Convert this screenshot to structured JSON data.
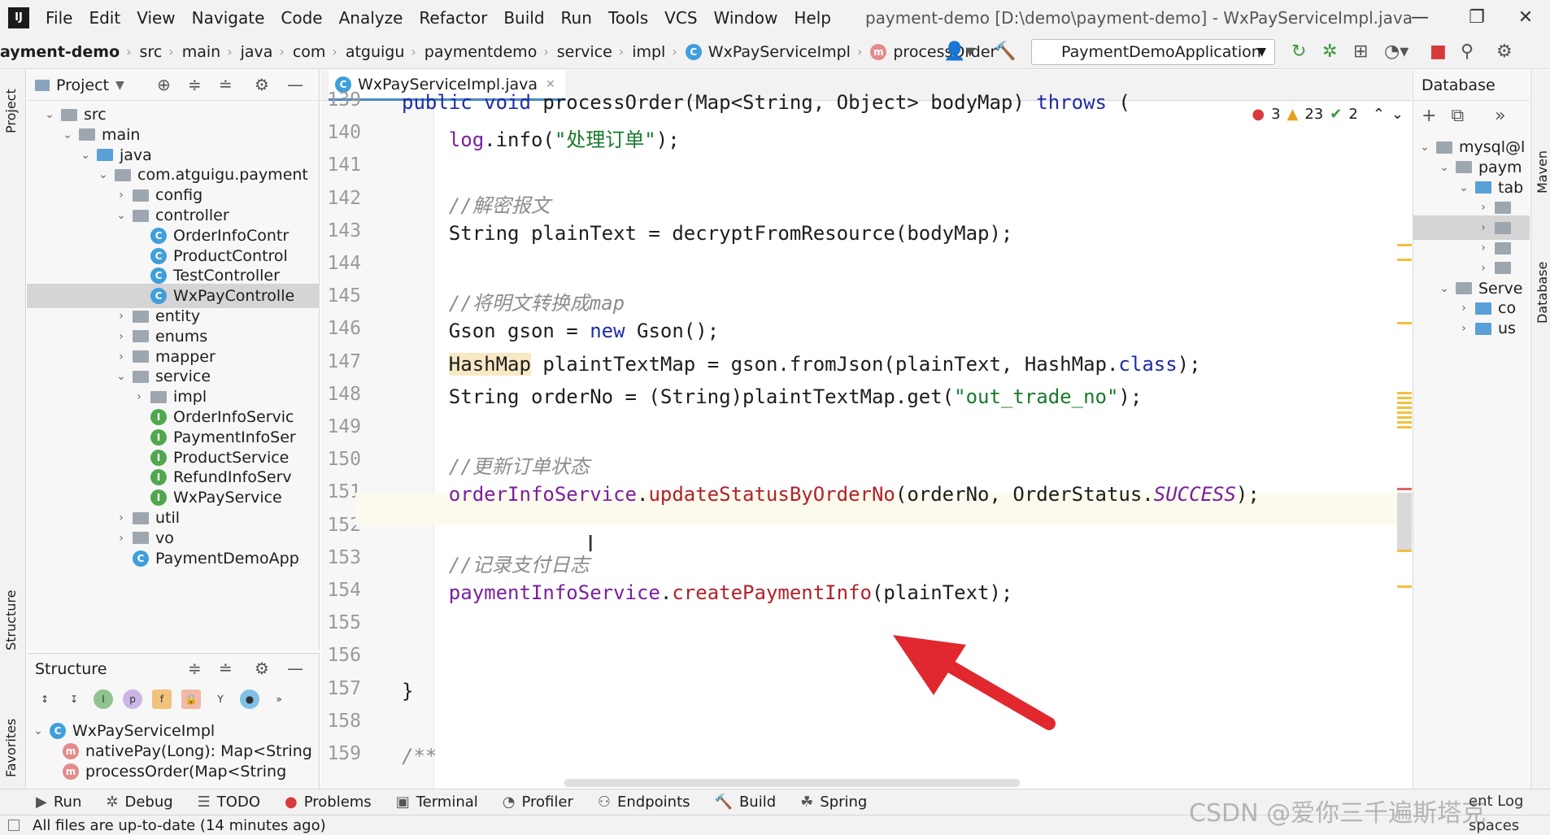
{
  "app": {
    "logo_text": "IJ"
  },
  "menu": {
    "items": [
      "File",
      "Edit",
      "View",
      "Navigate",
      "Code",
      "Analyze",
      "Refactor",
      "Build",
      "Run",
      "Tools",
      "VCS",
      "Window",
      "Help"
    ],
    "title": "payment-demo [D:\\demo\\payment-demo] - WxPayServiceImpl.java"
  },
  "window_controls": {
    "minimize": "—",
    "restore": "❐",
    "close": "✕"
  },
  "breadcrumbs": [
    "ayment-demo",
    "src",
    "main",
    "java",
    "com",
    "atguigu",
    "paymentdemo",
    "service",
    "impl",
    "WxPayServiceImpl",
    "processOrder"
  ],
  "run_config": {
    "name": "PaymentDemoApplication"
  },
  "project_panel": {
    "title": "Project",
    "tree": [
      {
        "label": "src",
        "depth": 0,
        "expanded": true,
        "type": "folder"
      },
      {
        "label": "main",
        "depth": 1,
        "expanded": true,
        "type": "folder"
      },
      {
        "label": "java",
        "depth": 2,
        "expanded": true,
        "type": "folder-blue"
      },
      {
        "label": "com.atguigu.payment",
        "depth": 3,
        "expanded": true,
        "type": "package"
      },
      {
        "label": "config",
        "depth": 4,
        "expanded": false,
        "type": "package"
      },
      {
        "label": "controller",
        "depth": 4,
        "expanded": true,
        "type": "package"
      },
      {
        "label": "OrderInfoContr",
        "depth": 5,
        "type": "class"
      },
      {
        "label": "ProductControl",
        "depth": 5,
        "type": "class"
      },
      {
        "label": "TestController",
        "depth": 5,
        "type": "class"
      },
      {
        "label": "WxPayControlle",
        "depth": 5,
        "type": "class",
        "selected": true
      },
      {
        "label": "entity",
        "depth": 4,
        "expanded": false,
        "type": "package"
      },
      {
        "label": "enums",
        "depth": 4,
        "expanded": false,
        "type": "package"
      },
      {
        "label": "mapper",
        "depth": 4,
        "expanded": false,
        "type": "package"
      },
      {
        "label": "service",
        "depth": 4,
        "expanded": true,
        "type": "package"
      },
      {
        "label": "impl",
        "depth": 5,
        "expanded": false,
        "type": "package"
      },
      {
        "label": "OrderInfoServic",
        "depth": 5,
        "type": "interface"
      },
      {
        "label": "PaymentInfoSer",
        "depth": 5,
        "type": "interface"
      },
      {
        "label": "ProductService",
        "depth": 5,
        "type": "interface"
      },
      {
        "label": "RefundInfoServ",
        "depth": 5,
        "type": "interface"
      },
      {
        "label": "WxPayService",
        "depth": 5,
        "type": "interface"
      },
      {
        "label": "util",
        "depth": 4,
        "expanded": false,
        "type": "package"
      },
      {
        "label": "vo",
        "depth": 4,
        "expanded": false,
        "type": "package"
      },
      {
        "label": "PaymentDemoApp",
        "depth": 4,
        "type": "class"
      }
    ]
  },
  "structure_panel": {
    "title": "Structure",
    "tree": [
      {
        "label": "WxPayServiceImpl",
        "depth": 0,
        "type": "class"
      },
      {
        "label": "nativePay(Long): Map<String",
        "depth": 1,
        "type": "method"
      },
      {
        "label": "processOrder(Map<String",
        "depth": 1,
        "type": "method"
      }
    ]
  },
  "left_strip": {
    "project": "Project",
    "structure": "Structure",
    "favorites": "Favorites"
  },
  "editor": {
    "tab": "WxPayServiceImpl.java",
    "inspections": {
      "errors": "3",
      "warnings": "23",
      "weak": "2"
    },
    "lines": [
      {
        "n": "139",
        "segments": [
          {
            "t": "public void ",
            "c": "kw"
          },
          {
            "t": "processOrder",
            "c": "fn"
          },
          {
            "t": "(Map<String, Object> bodyMap) ",
            "c": ""
          },
          {
            "t": "throws",
            "c": "kw"
          },
          {
            "t": " (",
            "c": ""
          }
        ]
      },
      {
        "n": "140",
        "segments": [
          {
            "t": "    ",
            "c": ""
          },
          {
            "t": "log",
            "c": "fld"
          },
          {
            "t": ".info(",
            "c": ""
          },
          {
            "t": "\"处理订单\"",
            "c": "str"
          },
          {
            "t": ");",
            "c": ""
          }
        ]
      },
      {
        "n": "141",
        "segments": []
      },
      {
        "n": "142",
        "segments": [
          {
            "t": "    //解密报文",
            "c": "cm"
          }
        ]
      },
      {
        "n": "143",
        "segments": [
          {
            "t": "    String plainText = decryptFromResource(bodyMap);",
            "c": ""
          }
        ]
      },
      {
        "n": "144",
        "segments": []
      },
      {
        "n": "145",
        "segments": [
          {
            "t": "    //将明文转换成map",
            "c": "cm"
          }
        ]
      },
      {
        "n": "146",
        "segments": [
          {
            "t": "    Gson gson = ",
            "c": ""
          },
          {
            "t": "new",
            "c": "kw"
          },
          {
            "t": " Gson();",
            "c": ""
          }
        ]
      },
      {
        "n": "147",
        "segments": [
          {
            "t": "    ",
            "c": ""
          },
          {
            "t": "HashMap",
            "c": "hl"
          },
          {
            "t": " plaintTextMap = gson.fromJson(plainText, HashMap.",
            "c": ""
          },
          {
            "t": "class",
            "c": "kw"
          },
          {
            "t": ");",
            "c": ""
          }
        ]
      },
      {
        "n": "148",
        "segments": [
          {
            "t": "    String orderNo = (String)plaintTextMap.get(",
            "c": ""
          },
          {
            "t": "\"out_trade_no\"",
            "c": "str"
          },
          {
            "t": ");",
            "c": ""
          }
        ]
      },
      {
        "n": "149",
        "segments": []
      },
      {
        "n": "150",
        "segments": [
          {
            "t": "    //更新订单状态",
            "c": "cm"
          }
        ]
      },
      {
        "n": "151",
        "segments": [
          {
            "t": "    ",
            "c": ""
          },
          {
            "t": "orderInfoService",
            "c": "fld"
          },
          {
            "t": ".",
            "c": ""
          },
          {
            "t": "updateStatusByOrderNo",
            "c": "mth"
          },
          {
            "t": "(orderNo, OrderStatus.",
            "c": ""
          },
          {
            "t": "SUCCESS",
            "c": "enm"
          },
          {
            "t": ");",
            "c": ""
          }
        ]
      },
      {
        "n": "152",
        "segments": []
      },
      {
        "n": "153",
        "segments": [
          {
            "t": "    //记录支付日志",
            "c": "cm"
          }
        ]
      },
      {
        "n": "154",
        "segments": [
          {
            "t": "    ",
            "c": ""
          },
          {
            "t": "paymentInfoService",
            "c": "fld"
          },
          {
            "t": ".",
            "c": ""
          },
          {
            "t": "createPaymentInfo",
            "c": "mth"
          },
          {
            "t": "(plainText);",
            "c": ""
          }
        ]
      },
      {
        "n": "155",
        "segments": []
      },
      {
        "n": "156",
        "segments": []
      },
      {
        "n": "157",
        "segments": [
          {
            "t": "}",
            "c": ""
          }
        ]
      },
      {
        "n": "158",
        "segments": []
      },
      {
        "n": "159",
        "segments": [
          {
            "t": "/**",
            "c": "cm"
          }
        ]
      }
    ]
  },
  "database_panel": {
    "title": "Database",
    "tree": [
      {
        "label": "mysql@l",
        "depth": 0
      },
      {
        "label": "paym",
        "depth": 1
      },
      {
        "label": "tab",
        "depth": 2
      },
      {
        "label": "",
        "depth": 3
      },
      {
        "label": "",
        "depth": 3
      },
      {
        "label": "",
        "depth": 3
      },
      {
        "label": "",
        "depth": 3
      },
      {
        "label": "Serve",
        "depth": 1
      },
      {
        "label": "co",
        "depth": 2
      },
      {
        "label": "us",
        "depth": 2
      }
    ]
  },
  "right_strip": {
    "maven": "Maven",
    "database": "Database"
  },
  "bottom_tools": [
    "Run",
    "Debug",
    "TODO",
    "Problems",
    "Terminal",
    "Profiler",
    "Endpoints",
    "Build",
    "Spring"
  ],
  "bottom_right": {
    "event_log": "ent Log",
    "spaces": "spaces"
  },
  "status": {
    "message": "All files are up-to-date (14 minutes ago)"
  },
  "watermark": {
    "text": "CSDN @爱你三千遍斯塔克"
  },
  "colors": {
    "accent": "#4a88c7",
    "arrow": "#e0282e"
  }
}
